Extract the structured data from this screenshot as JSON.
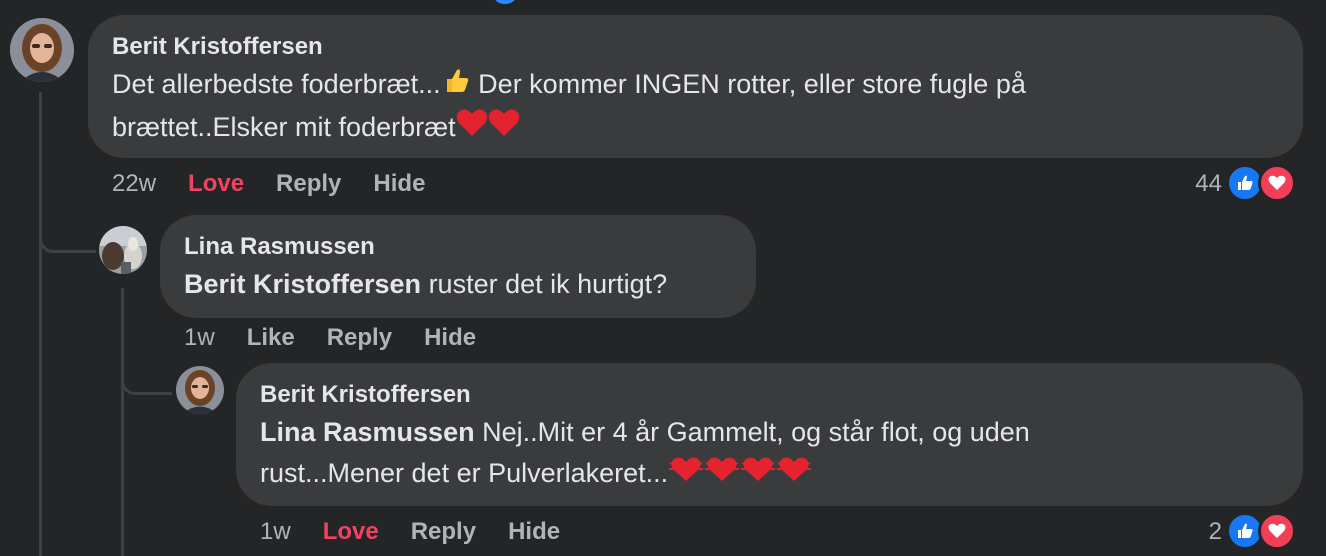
{
  "colors": {
    "background": "#242526",
    "bubble": "#3a3b3c",
    "love": "#f3425f",
    "like_blue": "#1877f2",
    "muted": "#b0b3b8"
  },
  "comments": [
    {
      "author": "Berit Kristoffersen",
      "line1": "Det allerbedste foderbræt...",
      "line1_after": " Der kommer INGEN rotter, eller store fugle på",
      "line2": "brættet..Elsker mit foderbræt",
      "emojis": [
        "thumbs-up",
        "red-heart",
        "red-heart"
      ],
      "age": "22w",
      "reaction_label": "Love",
      "reply": "Reply",
      "hide": "Hide",
      "reaction_count": "44",
      "reactions": [
        "like",
        "love"
      ]
    },
    {
      "author": "Lina Rasmussen",
      "mention": "Berit Kristoffersen",
      "text": " ruster det ik hurtigt?",
      "age": "1w",
      "reaction_label": "Like",
      "reply": "Reply",
      "hide": "Hide"
    },
    {
      "author": "Berit Kristoffersen",
      "mention": "Lina Rasmussen",
      "line1": " Nej..Mit er 4 år Gammelt, og står flot, og uden",
      "line2": "rust...Mener det er Pulverlakeret...",
      "emojis": [
        "heart-with-ribbon",
        "heart-with-ribbon",
        "heart-with-ribbon",
        "heart-with-ribbon"
      ],
      "age": "1w",
      "reaction_label": "Love",
      "reply": "Reply",
      "hide": "Hide",
      "reaction_count": "2",
      "reactions": [
        "like",
        "love"
      ]
    }
  ]
}
